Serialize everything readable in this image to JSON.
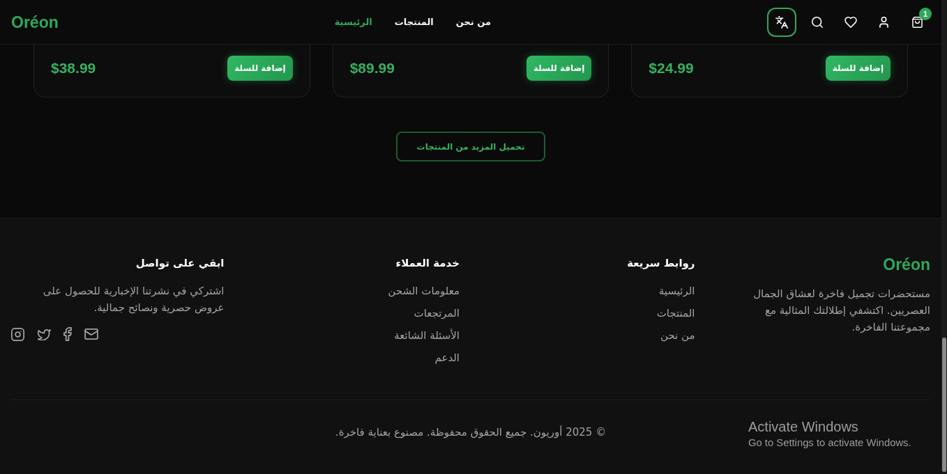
{
  "header": {
    "logo": "Oréon",
    "nav": [
      {
        "label": "من نحن",
        "selected": false
      },
      {
        "label": "المنتجات",
        "selected": false
      },
      {
        "label": "الرئيسية",
        "selected": true
      }
    ],
    "cart_count": "1"
  },
  "products": [
    {
      "price": "$24.99",
      "button": "إضافة للسلة"
    },
    {
      "price": "$89.99",
      "button": "إضافة للسلة"
    },
    {
      "price": "$38.99",
      "button": "إضافة للسلة"
    }
  ],
  "load_more": "تحميل المزيد من المنتجات",
  "footer": {
    "brand": {
      "logo": "Oréon",
      "description": "مستحضرات تجميل فاخرة لعشاق الجمال العصريين. اكتشفي إطلالتك المثالية مع مجموعتنا الفاخرة."
    },
    "columns": [
      {
        "title": "روابط سريعة",
        "links": [
          "الرئيسية",
          "المنتجات",
          "من نحن"
        ]
      },
      {
        "title": "خدمة العملاء",
        "links": [
          "معلومات الشحن",
          "المرتجعات",
          "الأسئلة الشائعة",
          "الدعم"
        ]
      }
    ],
    "contact": {
      "title": "ابقي على تواصل",
      "text": "اشتركي في نشرتنا الإخبارية للحصول على عروض حصرية ونصائح جمالية."
    },
    "copyright": "© 2025 أوريون. جميع الحقوق محفوظة. مصنوع بعناية فاخرة."
  },
  "os_notice": {
    "title": "Activate Windows",
    "text": "Go to Settings to activate Windows."
  }
}
